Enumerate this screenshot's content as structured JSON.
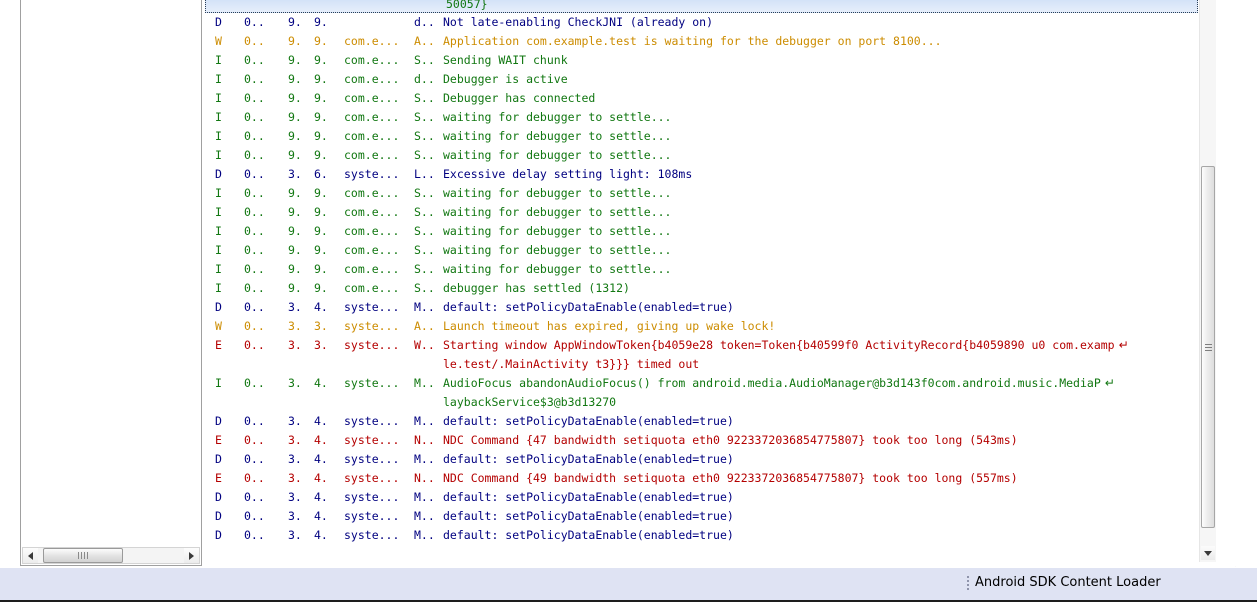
{
  "status_bar": {
    "label": "Android SDK Content Loader",
    "grip_icon": "vertical-dots-grip-icon"
  },
  "left_panel": {
    "scrollbar": {
      "left_arrow_icon": "triangle-left-icon",
      "right_arrow_icon": "triangle-right-icon",
      "grip_icon": "grip-icon"
    }
  },
  "logcat": {
    "vertical_scrollbar": {
      "grip_icon": "grip-icon",
      "down_arrow_icon": "triangle-down-icon"
    },
    "selected_row": {
      "message": "50057}"
    },
    "rows": [
      {
        "level": "D",
        "time": "0..",
        "pid": "9.",
        "tid": "9.",
        "app": "",
        "tag": "d..",
        "message": "Not late-enabling CheckJNI (already on)"
      },
      {
        "level": "W",
        "time": "0..",
        "pid": "9.",
        "tid": "9.",
        "app": "com.e...",
        "tag": "A..",
        "message": "Application com.example.test is waiting for the debugger on port 8100..."
      },
      {
        "level": "I",
        "time": "0..",
        "pid": "9.",
        "tid": "9.",
        "app": "com.e...",
        "tag": "S..",
        "message": "Sending WAIT chunk"
      },
      {
        "level": "I",
        "time": "0..",
        "pid": "9.",
        "tid": "9.",
        "app": "com.e...",
        "tag": "d..",
        "message": "Debugger is active"
      },
      {
        "level": "I",
        "time": "0..",
        "pid": "9.",
        "tid": "9.",
        "app": "com.e...",
        "tag": "S..",
        "message": "Debugger has connected"
      },
      {
        "level": "I",
        "time": "0..",
        "pid": "9.",
        "tid": "9.",
        "app": "com.e...",
        "tag": "S..",
        "message": "waiting for debugger to settle..."
      },
      {
        "level": "I",
        "time": "0..",
        "pid": "9.",
        "tid": "9.",
        "app": "com.e...",
        "tag": "S..",
        "message": "waiting for debugger to settle..."
      },
      {
        "level": "I",
        "time": "0..",
        "pid": "9.",
        "tid": "9.",
        "app": "com.e...",
        "tag": "S..",
        "message": "waiting for debugger to settle..."
      },
      {
        "level": "D",
        "time": "0..",
        "pid": "3.",
        "tid": "6.",
        "app": "syste...",
        "tag": "L..",
        "message": "Excessive delay setting light: 108ms"
      },
      {
        "level": "I",
        "time": "0..",
        "pid": "9.",
        "tid": "9.",
        "app": "com.e...",
        "tag": "S..",
        "message": "waiting for debugger to settle..."
      },
      {
        "level": "I",
        "time": "0..",
        "pid": "9.",
        "tid": "9.",
        "app": "com.e...",
        "tag": "S..",
        "message": "waiting for debugger to settle..."
      },
      {
        "level": "I",
        "time": "0..",
        "pid": "9.",
        "tid": "9.",
        "app": "com.e...",
        "tag": "S..",
        "message": "waiting for debugger to settle..."
      },
      {
        "level": "I",
        "time": "0..",
        "pid": "9.",
        "tid": "9.",
        "app": "com.e...",
        "tag": "S..",
        "message": "waiting for debugger to settle..."
      },
      {
        "level": "I",
        "time": "0..",
        "pid": "9.",
        "tid": "9.",
        "app": "com.e...",
        "tag": "S..",
        "message": "waiting for debugger to settle..."
      },
      {
        "level": "I",
        "time": "0..",
        "pid": "9.",
        "tid": "9.",
        "app": "com.e...",
        "tag": "S..",
        "message": "debugger has settled (1312)"
      },
      {
        "level": "D",
        "time": "0..",
        "pid": "3.",
        "tid": "4.",
        "app": "syste...",
        "tag": "M..",
        "message": "default: setPolicyDataEnable(enabled=true)"
      },
      {
        "level": "W",
        "time": "0..",
        "pid": "3.",
        "tid": "3.",
        "app": "syste...",
        "tag": "A..",
        "message": "Launch timeout has expired, giving up wake lock!"
      },
      {
        "level": "E",
        "time": "0..",
        "pid": "3.",
        "tid": "3.",
        "app": "syste...",
        "tag": "W..",
        "message": "Starting window AppWindowToken{b4059e28 token=Token{b40599f0 ActivityRecord{b4059890 u0 com.examp",
        "wrapped": true,
        "continuation": "le.test/.MainActivity t3}}} timed out"
      },
      {
        "level": "I",
        "time": "0..",
        "pid": "3.",
        "tid": "4.",
        "app": "syste...",
        "tag": "M..",
        "message": "  AudioFocus  abandonAudioFocus() from android.media.AudioManager@b3d143f0com.android.music.MediaP",
        "wrapped": true,
        "continuation": "laybackService$3@b3d13270"
      },
      {
        "level": "D",
        "time": "0..",
        "pid": "3.",
        "tid": "4.",
        "app": "syste...",
        "tag": "M..",
        "message": "default: setPolicyDataEnable(enabled=true)"
      },
      {
        "level": "E",
        "time": "0..",
        "pid": "3.",
        "tid": "4.",
        "app": "syste...",
        "tag": "N..",
        "message": "NDC Command {47 bandwidth setiquota eth0 9223372036854775807} took too long (543ms)"
      },
      {
        "level": "D",
        "time": "0..",
        "pid": "3.",
        "tid": "4.",
        "app": "syste...",
        "tag": "M..",
        "message": "default: setPolicyDataEnable(enabled=true)"
      },
      {
        "level": "E",
        "time": "0..",
        "pid": "3.",
        "tid": "4.",
        "app": "syste...",
        "tag": "N..",
        "message": "NDC Command {49 bandwidth setiquota eth0 9223372036854775807} took too long (557ms)"
      },
      {
        "level": "D",
        "time": "0..",
        "pid": "3.",
        "tid": "4.",
        "app": "syste...",
        "tag": "M..",
        "message": "default: setPolicyDataEnable(enabled=true)"
      },
      {
        "level": "D",
        "time": "0..",
        "pid": "3.",
        "tid": "4.",
        "app": "syste...",
        "tag": "M..",
        "message": "default: setPolicyDataEnable(enabled=true)"
      },
      {
        "level": "D",
        "time": "0..",
        "pid": "3.",
        "tid": "4.",
        "app": "syste...",
        "tag": "M..",
        "message": "default: setPolicyDataEnable(enabled=true)"
      }
    ]
  },
  "colors": {
    "debug": "#000080",
    "info": "#117711",
    "warn": "#cc8c00",
    "error": "#b40000",
    "selection": "#dbe8fa",
    "status_bar": "#dfe3f3"
  }
}
